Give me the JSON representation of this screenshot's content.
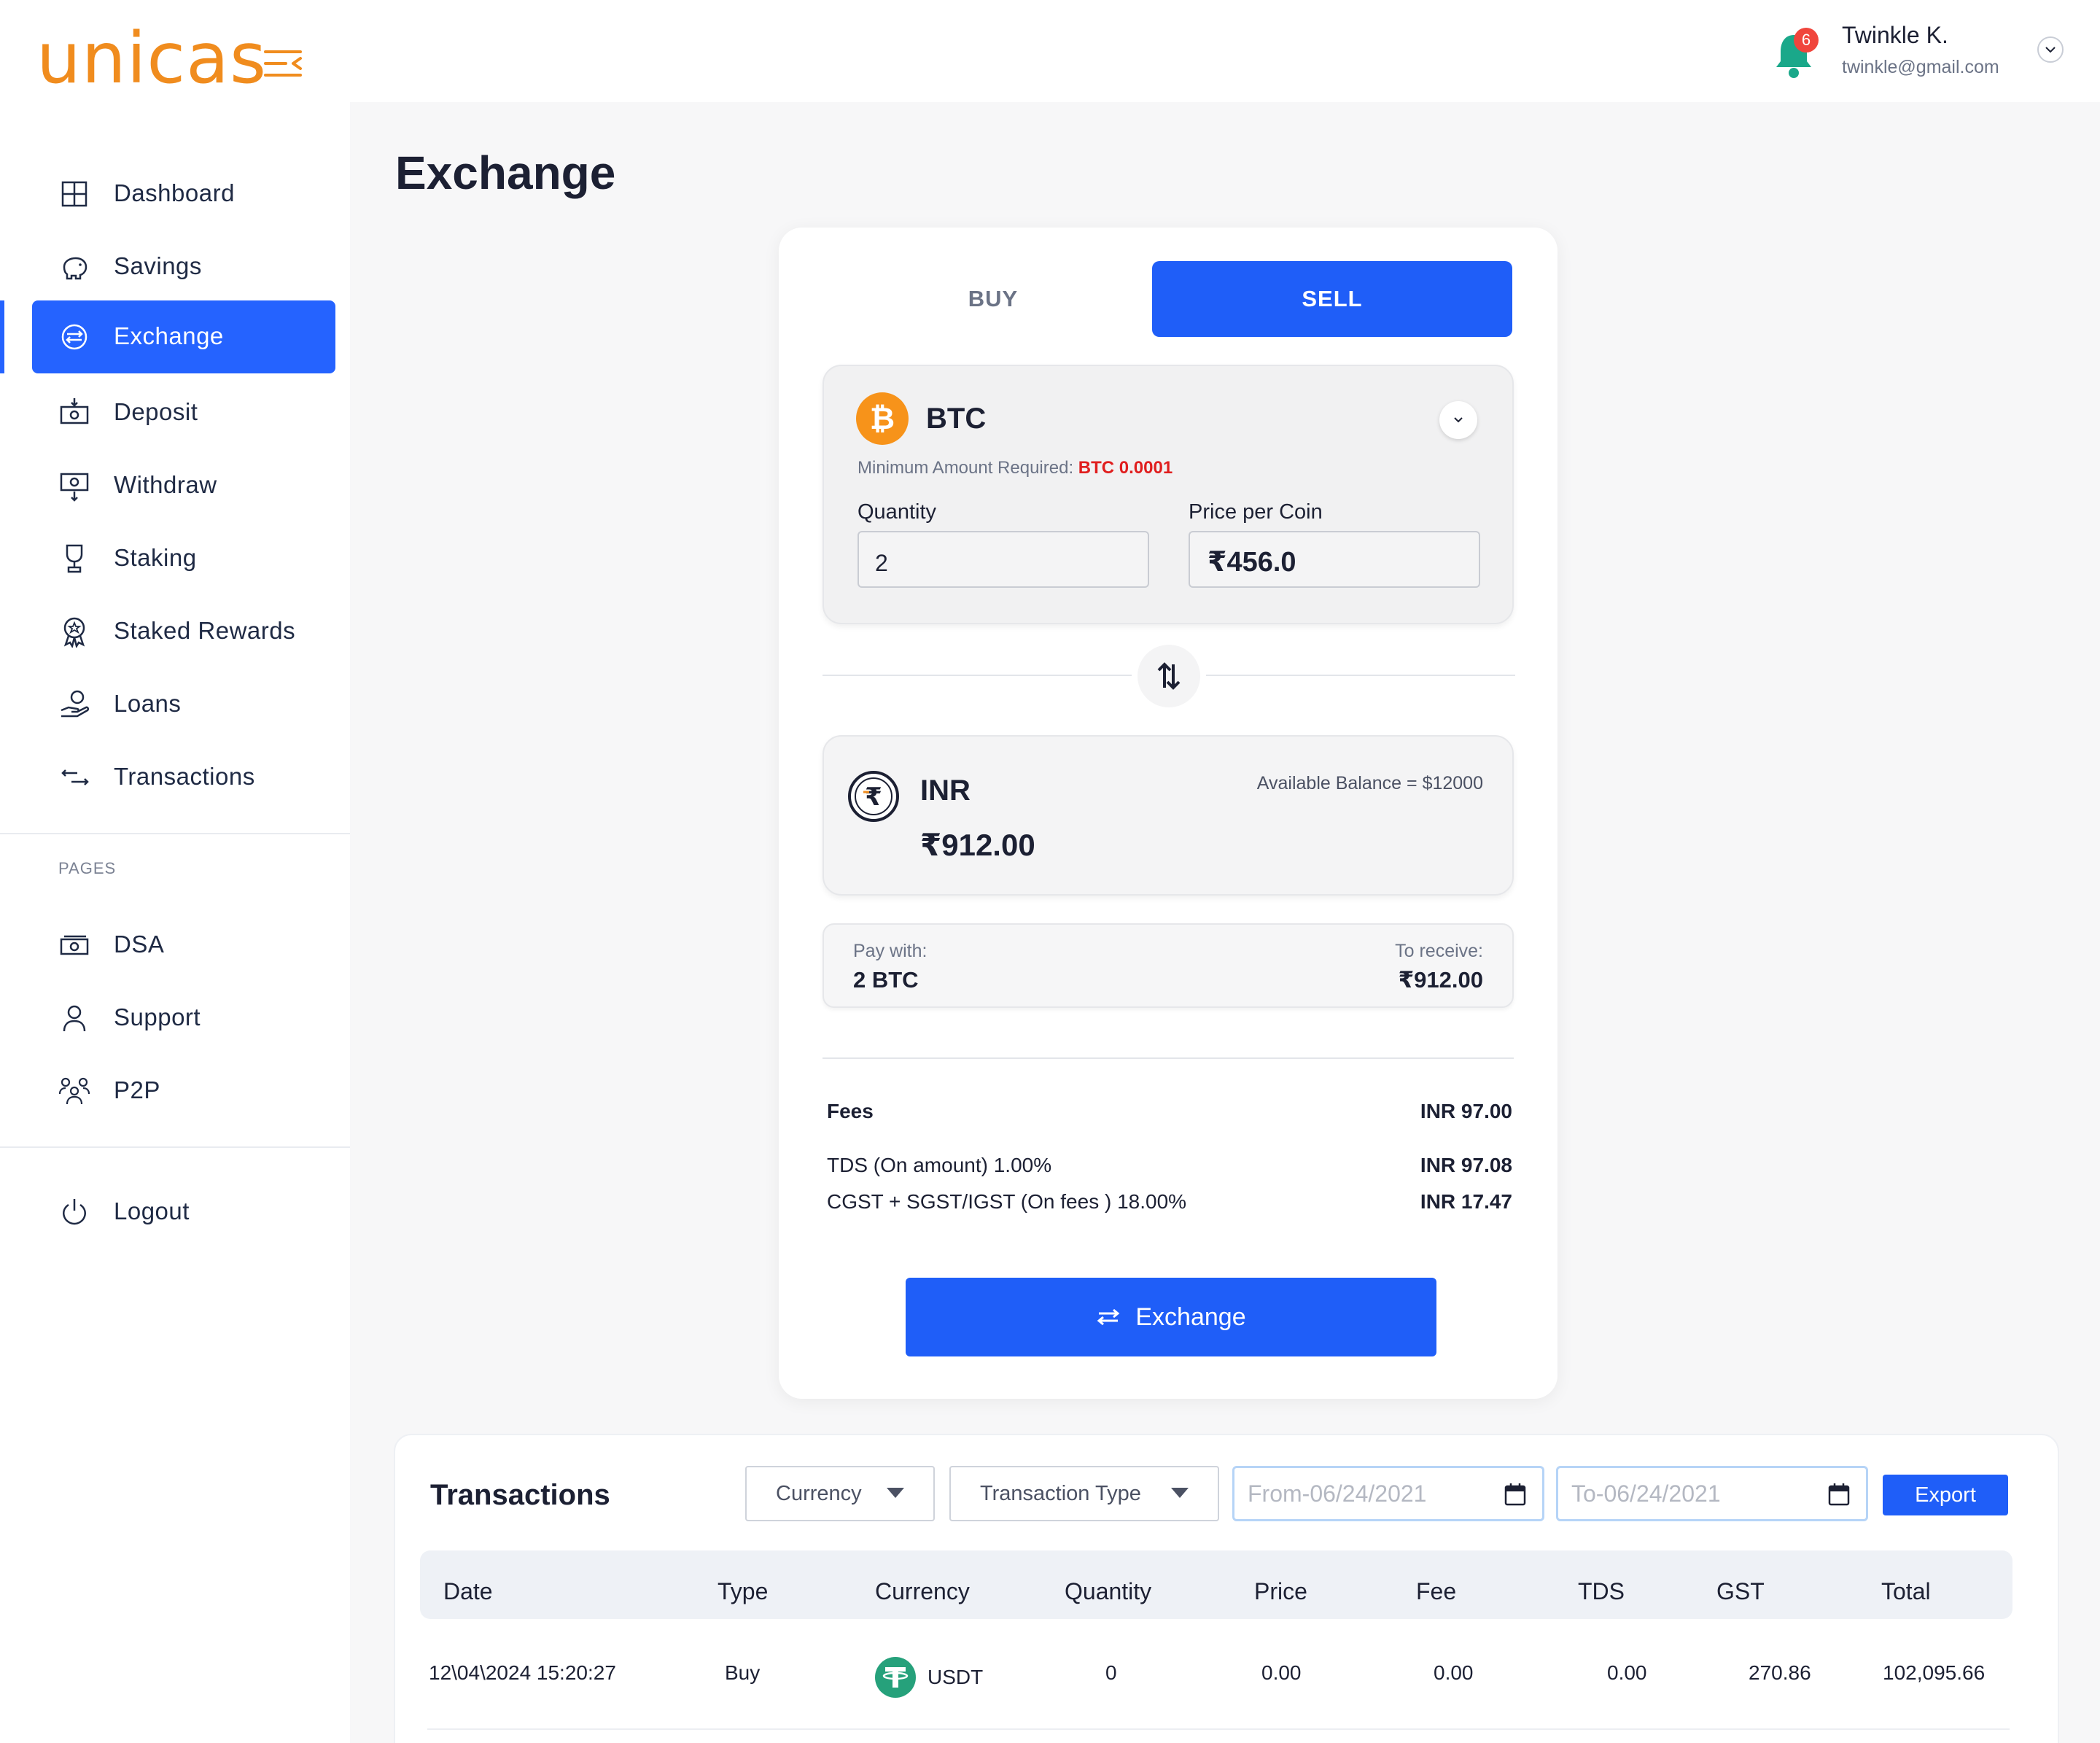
{
  "header": {
    "logo": "unicas",
    "notification_count": "6",
    "user_name": "Twinkle K.",
    "user_email": "twinkle@gmail.com"
  },
  "sidebar": {
    "items": [
      {
        "label": "Dashboard",
        "icon": "dashboard-icon"
      },
      {
        "label": "Savings",
        "icon": "piggy-bank-icon"
      },
      {
        "label": "Exchange",
        "icon": "exchange-icon",
        "active": true
      },
      {
        "label": "Deposit",
        "icon": "deposit-icon"
      },
      {
        "label": "Withdraw",
        "icon": "withdraw-icon"
      },
      {
        "label": "Staking",
        "icon": "trophy-icon"
      },
      {
        "label": "Staked Rewards",
        "icon": "reward-badge-icon"
      },
      {
        "label": "Loans",
        "icon": "loan-hand-icon"
      },
      {
        "label": "Transactions",
        "icon": "transactions-arrows-icon"
      }
    ],
    "pages_label": "PAGES",
    "pages": [
      {
        "label": "DSA",
        "icon": "cash-icon"
      },
      {
        "label": "Support",
        "icon": "user-icon"
      },
      {
        "label": "P2P",
        "icon": "group-icon"
      }
    ],
    "logout_label": "Logout"
  },
  "page": {
    "title": "Exchange"
  },
  "exchange": {
    "tab_buy": "BUY",
    "tab_sell": "SELL",
    "active_tab": "SELL",
    "coin": "BTC",
    "min_required_label": "Minimum Amount Required:",
    "min_required_value": "BTC 0.0001",
    "quantity_label": "Quantity",
    "quantity_value": "2",
    "price_label": "Price per Coin",
    "price_value": "₹456.0",
    "target_currency": "INR",
    "available_balance": "Available Balance = $12000",
    "target_amount": "₹912.00",
    "pay_with_label": "Pay with:",
    "pay_with_value": "2 BTC",
    "to_receive_label": "To receive:",
    "to_receive_value": "₹912.00",
    "fees": [
      {
        "label": "Fees",
        "value": "INR 97.00"
      },
      {
        "label": "TDS (On amount) 1.00%",
        "value": "INR 97.08"
      },
      {
        "label": "CGST + SGST/IGST (On fees ) 18.00%",
        "value": "INR 17.47"
      }
    ],
    "submit_label": "Exchange"
  },
  "transactions": {
    "title": "Transactions",
    "currency_filter": "Currency",
    "type_filter": "Transaction Type",
    "from_date": "From-06/24/2021",
    "to_date": "To-06/24/2021",
    "export_label": "Export",
    "columns": [
      "Date",
      "Type",
      "Currency",
      "Quantity",
      "Price",
      "Fee",
      "TDS",
      "GST",
      "Total"
    ],
    "rows": [
      {
        "date": "12\\04\\2024 15:20:27",
        "type": "Buy",
        "currency": "USDT",
        "quantity": "0",
        "price": "0.00",
        "fee": "0.00",
        "tds": "0.00",
        "gst": "270.86",
        "total": "102,095.66"
      }
    ]
  },
  "colors": {
    "accent": "#1f5ef8",
    "brand": "#f08c1e",
    "bitcoin": "#f7931a",
    "tether": "#26a17b",
    "notification": "#f0453c"
  }
}
